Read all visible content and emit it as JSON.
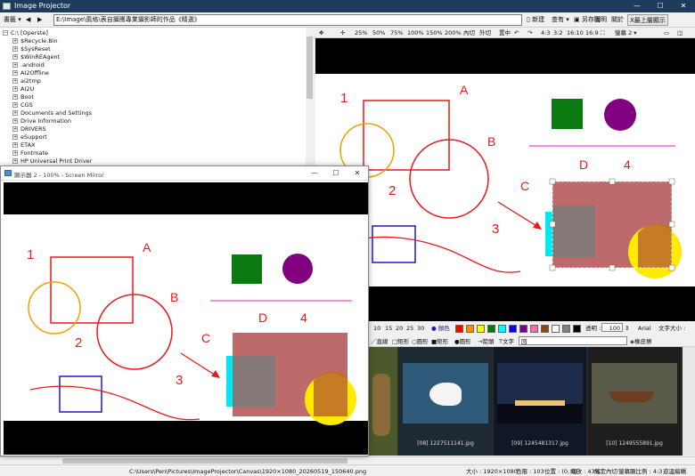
{
  "window": {
    "title": "Image Projector",
    "controls": [
      "—",
      "☐",
      "✕"
    ]
  },
  "toolbar": {
    "bookmark": "書籤",
    "nav_back": "◀",
    "nav_forward": "▶",
    "path": "E:\\Image\\風格\\表自攝團專業攝影師的作品《精選》",
    "new": "新建",
    "open": "查有",
    "save": "另存圖",
    "help": "說明",
    "about": "關於",
    "always_on_top": "X最上層顯示"
  },
  "tree": {
    "root": "C:\\ [Operste]",
    "items": [
      "$Recycle.Bin",
      "$SysReset",
      "$WinREAgent",
      ".android",
      "AI2Offline",
      "ai2tmp",
      "AI2U",
      "Boot",
      "CGS",
      "Documents and Settings",
      "Drive Information",
      "DRIVERS",
      "eSupport",
      "ETAX",
      "Fontmate",
      "HP Universal Print Driver"
    ]
  },
  "view_toolbar": {
    "zoom_levels": [
      "25%",
      "50%",
      "75%",
      "100%",
      "150%",
      "200%"
    ],
    "fit": "內切",
    "fill": "外切",
    "center": "置中",
    "ratios": [
      "4:3",
      "3:2",
      "16:10",
      "16:9"
    ],
    "screen": "螢幕 2 ▾"
  },
  "canvas": {
    "label_A": "A",
    "label_B": "B",
    "label_C": "C",
    "label_D": "D",
    "num_1": "1",
    "num_2": "2",
    "num_3": "3",
    "num_4": "4"
  },
  "palette": {
    "sizes": [
      "10",
      "15",
      "20",
      "25",
      "30"
    ],
    "color_label": "● 顏色",
    "swatches": [
      "#ff0000",
      "#ff8c00",
      "#ffff00",
      "#008000",
      "#00ffff",
      "#0000ff",
      "#800080",
      "#ff69b4",
      "#8b4513",
      "#ffffff",
      "#808080",
      "#000000"
    ],
    "transparency_label": "透明 :",
    "transparency_value": "100",
    "font": "Arial",
    "font_size_label": "文字大小 :"
  },
  "shapes": {
    "line": "直線",
    "rect": "矩形",
    "circle": "圓形",
    "frame": "矩形",
    "dot": "圓形",
    "arrow": "箭頭",
    "text": "文字",
    "text_value": "回",
    "eraser": "橡皮擦"
  },
  "thumbnails": [
    {
      "caption": ""
    },
    {
      "caption": "[08] 1227511141.jpg"
    },
    {
      "caption": "[09] 1245481317.jpg"
    },
    {
      "caption": "[10] 1249555891.jpg"
    },
    {
      "caption": ""
    }
  ],
  "mirror": {
    "title": "顯示器 2 - 100% - Screen Mirror",
    "controls": [
      "—",
      "☐",
      "✕"
    ]
  },
  "status": {
    "path": "C:\\Users\\Pen\\Pictures\\ImageProjector\\Canvas\\1920×1080_20260519_150640.png",
    "size": "大小 : 1920×1080",
    "colors": "色階 : 103",
    "position": "位置 : (0, 0)",
    "zoom": "縮放 : 43%",
    "fit_mode": "縮定內切",
    "aspect": "螢幕顯比例 : 4:3",
    "edit": "遊溫編輯"
  },
  "colors": {
    "accent_red": "#e8191b",
    "orange": "#f0a000",
    "blue": "#1a1acc",
    "green": "#0a7a10",
    "purple": "#800080",
    "pink": "#f06ad0",
    "cyan": "#00e8f0",
    "yellow": "#ffea00",
    "brown": "#b55a5a",
    "gray": "#7a7a7a"
  }
}
